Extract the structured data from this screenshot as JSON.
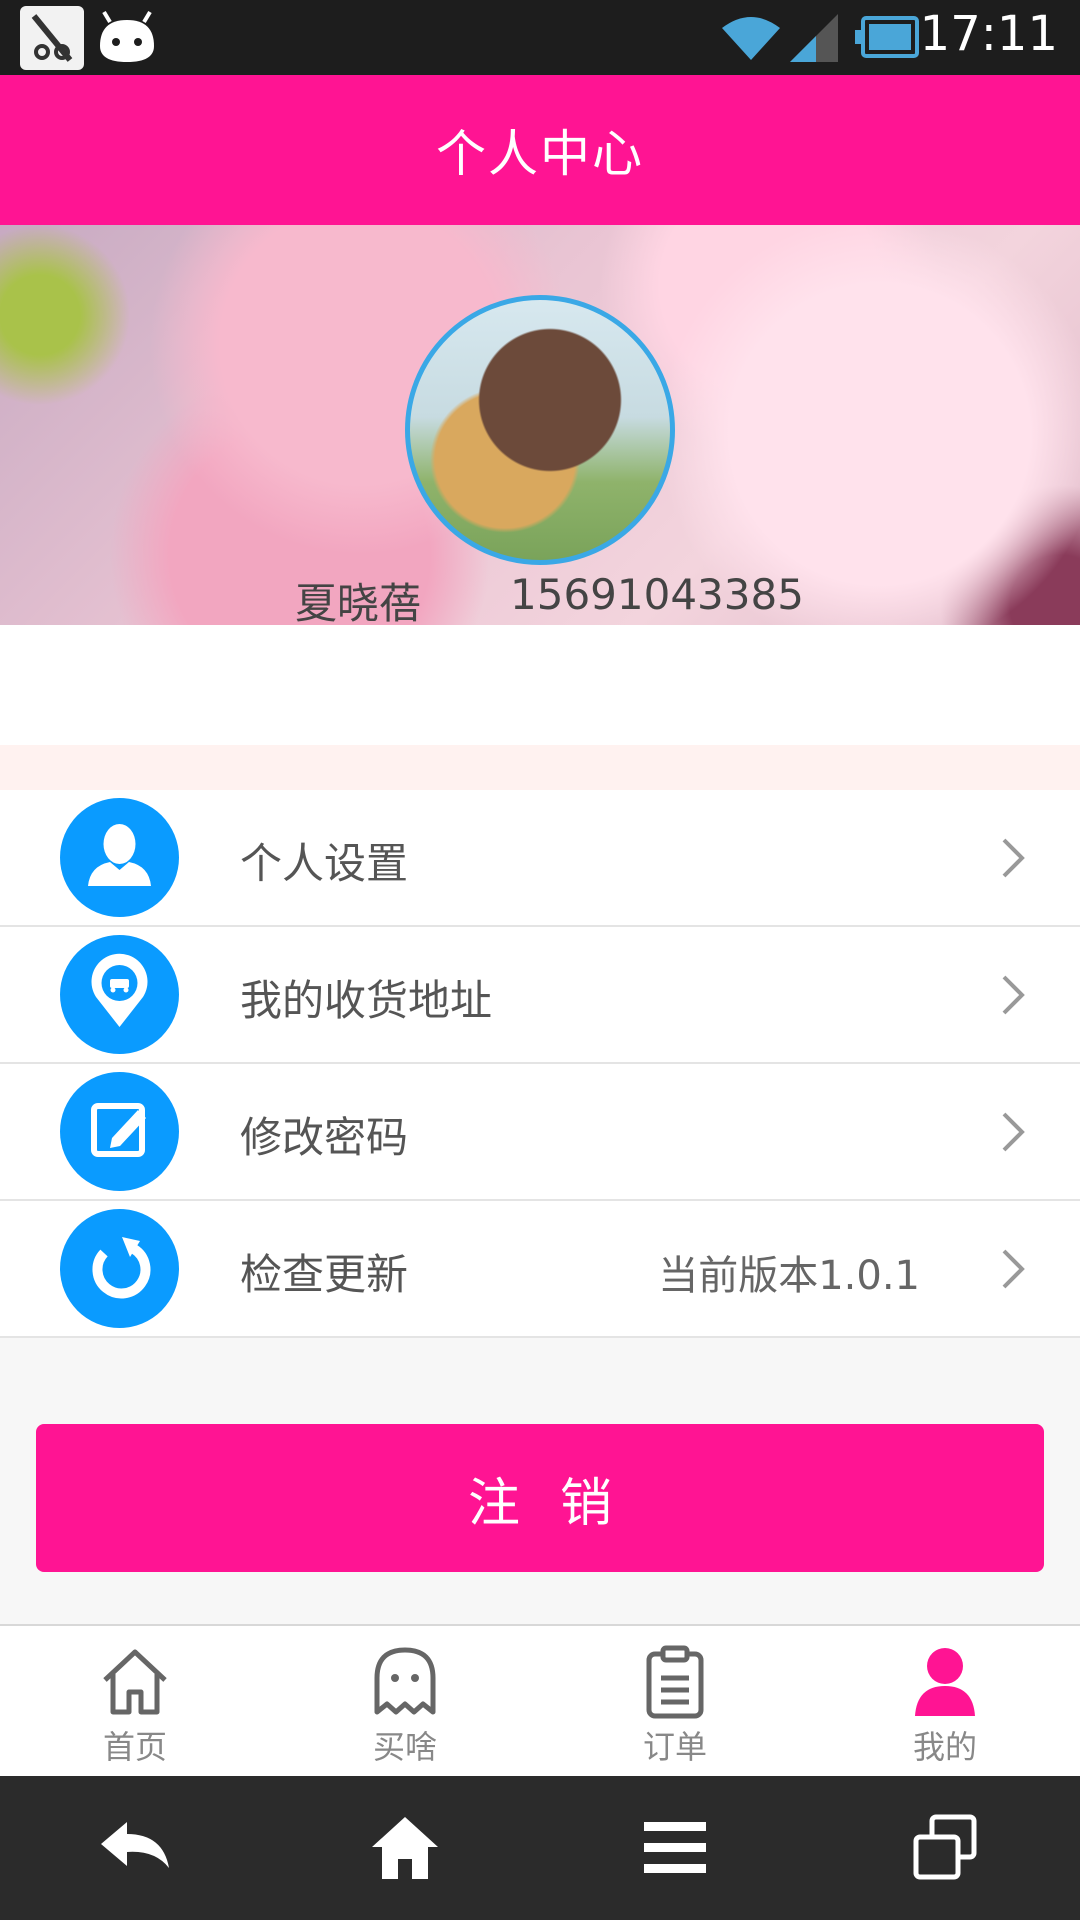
{
  "status_bar": {
    "time": "17:11"
  },
  "header": {
    "title": "个人中心"
  },
  "profile": {
    "name": "夏晓蓓",
    "phone": "15691043385"
  },
  "menu": {
    "items": [
      {
        "label": "个人设置",
        "icon": "person-icon"
      },
      {
        "label": "我的收货地址",
        "icon": "location-car-icon"
      },
      {
        "label": "修改密码",
        "icon": "edit-icon"
      },
      {
        "label": "检查更新",
        "icon": "refresh-icon",
        "extra": "当前版本1.0.1"
      }
    ]
  },
  "logout": {
    "label": "注销"
  },
  "tabs": [
    {
      "label": "首页",
      "icon": "home-icon",
      "active": false
    },
    {
      "label": "买啥",
      "icon": "ghost-icon",
      "active": false
    },
    {
      "label": "订单",
      "icon": "clipboard-icon",
      "active": false
    },
    {
      "label": "我的",
      "icon": "person-icon",
      "active": true
    }
  ],
  "colors": {
    "accent": "#ff1493",
    "icon_blue": "#0a9bff",
    "tab_active": "#ff1493",
    "tab_inactive": "#888888"
  }
}
